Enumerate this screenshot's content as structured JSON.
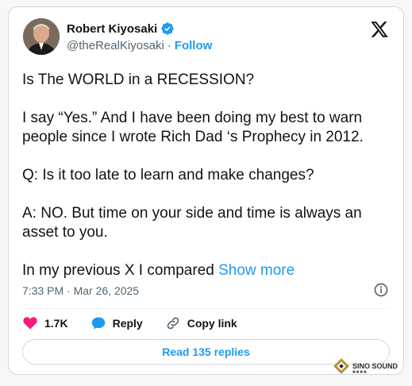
{
  "author": {
    "display_name": "Robert Kiyosaki",
    "handle": "@theRealKiyosaki",
    "separator": "·",
    "follow_label": "Follow",
    "avatar_icon": "profile-photo",
    "verified_icon": "verified-badge-icon"
  },
  "tweet": {
    "paragraphs": [
      "Is The WORLD in a RECESSION?",
      "I say “Yes.”  And  I have been doing my best to warn people since I wrote Rich Dad ‘s Prophecy in 2012.",
      "Q:  Is it too late to learn and make changes?",
      "A:  NO.  But time on your side and time is always an asset to you."
    ],
    "truncated_text": "In my previous X I compared ",
    "show_more_label": "Show more"
  },
  "meta": {
    "timestamp": "7:33 PM · Mar 26, 2025"
  },
  "actions": {
    "likes_count": "1.7K",
    "reply_label": "Reply",
    "copy_link_label": "Copy link"
  },
  "read_replies_label": "Read 135 replies",
  "watermark": {
    "title": "SINO SOUND",
    "subtitle": "■■■■"
  },
  "colors": {
    "accent": "#1d9bf0",
    "like": "#f91880",
    "text": "#0f1419",
    "muted": "#536471"
  }
}
